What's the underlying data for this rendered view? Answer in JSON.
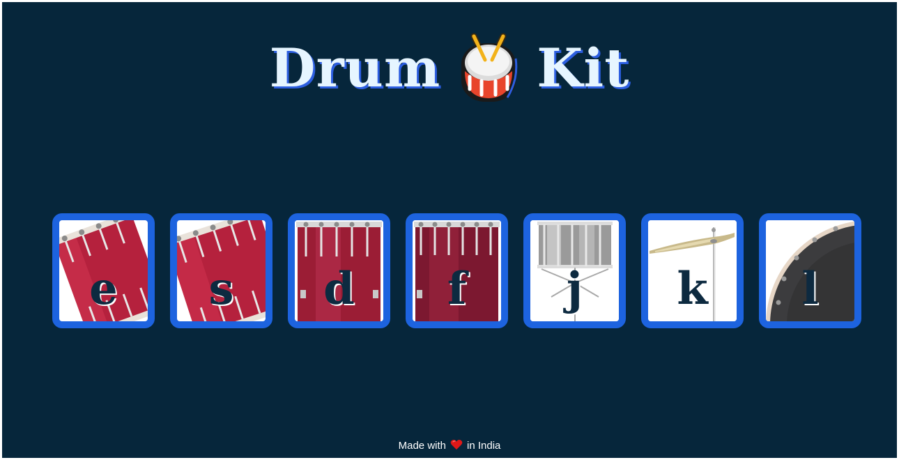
{
  "header": {
    "title_left": "Drum",
    "title_right": "Kit",
    "title_icon": "drum-emoji-icon"
  },
  "pads": [
    {
      "key": "e",
      "instrument_icon": "tom-1-icon"
    },
    {
      "key": "s",
      "instrument_icon": "tom-2-icon"
    },
    {
      "key": "d",
      "instrument_icon": "tom-3-icon"
    },
    {
      "key": "f",
      "instrument_icon": "tom-4-icon"
    },
    {
      "key": "j",
      "instrument_icon": "snare-icon"
    },
    {
      "key": "k",
      "instrument_icon": "crash-cymbal-icon"
    },
    {
      "key": "l",
      "instrument_icon": "kick-bass-icon"
    }
  ],
  "footer": {
    "prefix": "Made with",
    "icon": "heart-icon",
    "suffix": "in India"
  },
  "colors": {
    "background": "#06263b",
    "pad_border": "#1d63df",
    "title_text": "#e6f5ff",
    "title_shadow": "#2c5ee0",
    "key_text": "#0d2a40"
  }
}
